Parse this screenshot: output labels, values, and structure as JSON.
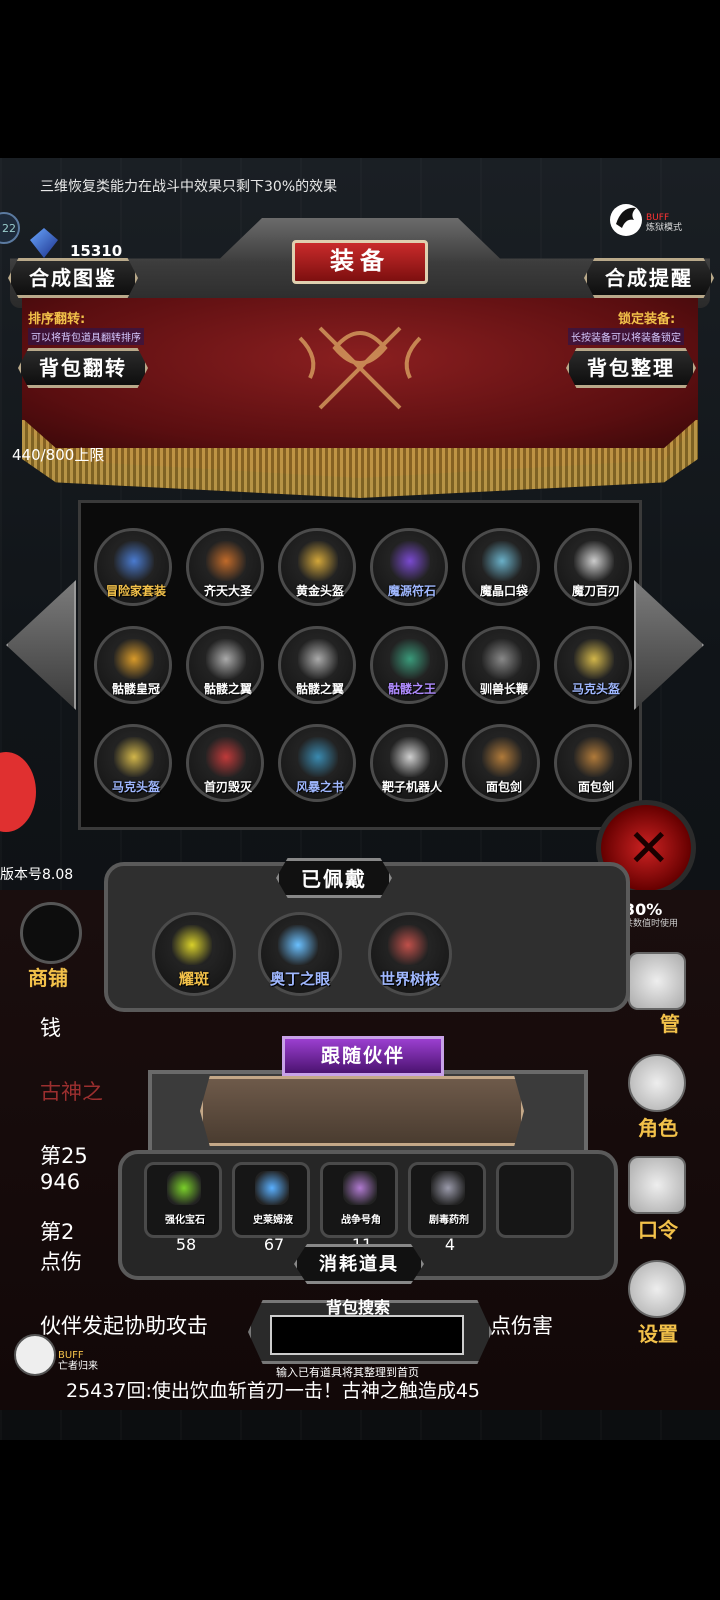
{
  "notice": "三维恢复类能力在战斗中效果只剩下30%的效果",
  "currency": {
    "gems": "15310",
    "level_badge": "22"
  },
  "buff": {
    "line1": "BUFF",
    "line2": "炼狱模式"
  },
  "title": "装备",
  "buttons": {
    "recipe_book": "合成图鉴",
    "craft_reminder": "合成提醒",
    "flip_bag": "背包翻转",
    "sort_bag": "背包整理"
  },
  "hints": {
    "sort_flip_title": "排序翻转:",
    "sort_flip_desc": "可以将背包道具翻转排序",
    "lock_title": "锁定装备:",
    "lock_desc": "长按装备可以将装备锁定"
  },
  "capacity": "440/800上限",
  "inventory": [
    {
      "name": "冒险家套装",
      "color": "#f2c14a"
    },
    {
      "name": "齐天大圣",
      "color": "#ffffff"
    },
    {
      "name": "黄金头盔",
      "color": "#ffffff"
    },
    {
      "name": "魔源符石",
      "color": "#a0b8ff"
    },
    {
      "name": "魔晶口袋",
      "color": "#ffffff"
    },
    {
      "name": "魔刀百刃",
      "color": "#ffffff"
    },
    {
      "name": "骷髅皇冠",
      "color": "#ffffff"
    },
    {
      "name": "骷髅之翼",
      "color": "#ffffff"
    },
    {
      "name": "骷髅之翼",
      "color": "#ffffff"
    },
    {
      "name": "骷髅之王",
      "color": "#b08cff"
    },
    {
      "name": "驯兽长鞭",
      "color": "#ffffff"
    },
    {
      "name": "马克头盔",
      "color": "#a0b8ff"
    },
    {
      "name": "马克头盔",
      "color": "#a0b8ff"
    },
    {
      "name": "首刃毁灭",
      "color": "#ffffff"
    },
    {
      "name": "风暴之书",
      "color": "#a0b8ff"
    },
    {
      "name": "靶子机器人",
      "color": "#ffffff"
    },
    {
      "name": "面包剑",
      "color": "#ffffff"
    },
    {
      "name": "面包剑",
      "color": "#ffffff"
    }
  ],
  "version": "版本号8.08",
  "equipped": {
    "label": "已佩戴",
    "items": [
      {
        "name": "耀斑",
        "color": "#f2c14a"
      },
      {
        "name": "奥丁之眼",
        "color": "#a0b8ff"
      },
      {
        "name": "世界树枝",
        "color": "#a0b8ff"
      }
    ]
  },
  "companion_label": "跟随伙伴",
  "consumables": {
    "label": "消耗道具",
    "items": [
      {
        "name": "强化宝石",
        "count": "58"
      },
      {
        "name": "史莱姆液",
        "count": "67"
      },
      {
        "name": "战争号角",
        "count": "11"
      },
      {
        "name": "剧毒药剂",
        "count": "4"
      }
    ]
  },
  "search": {
    "title": "背包搜索",
    "hint": "输入已有道具将其整理到首页",
    "value": ""
  },
  "side_menu": {
    "shop": "商铺",
    "manage": "管",
    "role": "角色",
    "command": "口令",
    "settings": "设置",
    "dice_text": "30%",
    "dice_sub": "共数值时使用"
  },
  "log": {
    "coin": "钱",
    "ancient": "古神之",
    "l1": "第25",
    "l2": "946",
    "l3": "第2",
    "l4": "点伤",
    "assist_left": "伙伴发起协助攻击",
    "assist_right": "点伤害",
    "bottom": "25437回:使出饮血斩首刃一击！古神之触造成45"
  },
  "skull": {
    "line1": "BUFF",
    "line2": "亡者归来"
  }
}
